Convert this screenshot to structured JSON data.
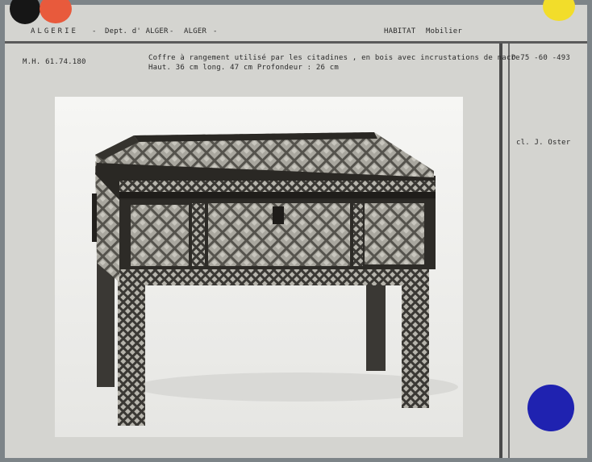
{
  "header": {
    "region": "ALGERIE",
    "dash1": "-",
    "department": "Dept. d' ALGER",
    "dash2": "-",
    "city": "ALGER",
    "dash3": "-",
    "category": "HABITAT",
    "subcategory": "Mobilier"
  },
  "record": {
    "inventory_number": "M.H. 61.74.180",
    "description": "Coffre à rangement utilisé par les citadines , en bois avec incrustations de nacre.",
    "dimensions": "Haut. 36 cm   long. 47 cm   Profondeur : 26 cm",
    "photo_reference": "D 75 -60 -493",
    "photo_credit": "cl. J. Oster"
  },
  "colors": {
    "card_background": "#d4d4d0",
    "dot_black": "#161616",
    "dot_red": "#e85a3c",
    "dot_yellow": "#f2dd2a",
    "dot_blue": "#1f22b0"
  }
}
